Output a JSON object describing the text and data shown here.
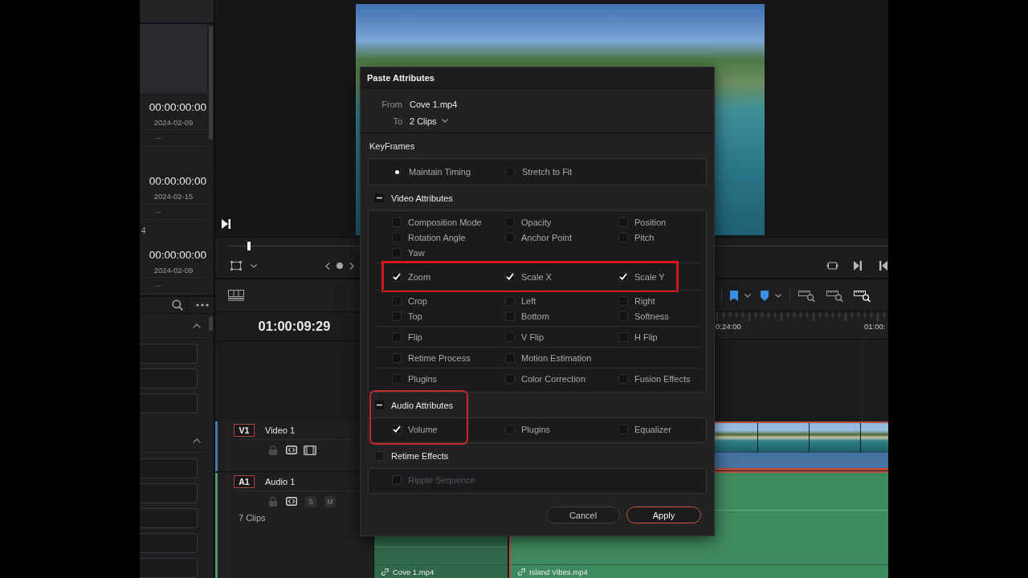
{
  "media_pool": {
    "clips": [
      {
        "timecode": "00:00:00:00",
        "date": "2024-02-09",
        "note": "---"
      },
      {
        "timecode": "00:00:00:00",
        "date": "2024-02-15",
        "note": "---",
        "partial_label": "4"
      },
      {
        "timecode": "00:00:00:00",
        "date": "2024-02-09",
        "note": "---"
      }
    ]
  },
  "inspector_panel": {
    "sections": [
      {
        "expanded": true
      },
      {
        "expanded": true
      }
    ]
  },
  "viewer": {
    "scrubber": {
      "level": 0.03
    }
  },
  "timeline": {
    "timecode": "01:00:09:29",
    "ruler": [
      "0:24:00",
      "01:00:"
    ],
    "tracks": [
      {
        "kind": "video",
        "badge": "V1",
        "name": "Video 1",
        "color": "#4a78b0"
      },
      {
        "kind": "audio",
        "badge": "A1",
        "name": "Audio 1",
        "color": "#4f9a6a",
        "buttons": [
          "S",
          "M"
        ],
        "clip_count": "7 Clips"
      }
    ],
    "video_clips": [
      {
        "selected": true
      }
    ],
    "audio_clips": [
      {
        "name": "Cove 1.mp4",
        "selected": false
      },
      {
        "name": "Island Vibes.mp4",
        "selected": true
      }
    ]
  },
  "dialog": {
    "title": "Paste Attributes",
    "from": {
      "label": "From",
      "value": "Cove 1.mp4"
    },
    "to": {
      "label": "To",
      "value": "2 Clips"
    },
    "keyframes": {
      "label": "KeyFrames",
      "options": [
        {
          "label": "Maintain Timing",
          "selected": true
        },
        {
          "label": "Stretch to Fit",
          "selected": false
        }
      ]
    },
    "sections": [
      {
        "kind": "toggle",
        "label": "Video Attributes",
        "expanded": true,
        "groups": [
          {
            "disabled": false,
            "items": [
              {
                "label": "Composition Mode",
                "checked": false
              },
              {
                "label": "Opacity",
                "checked": false
              },
              {
                "label": "Position",
                "checked": false
              },
              {
                "label": "Rotation Angle",
                "checked": false
              },
              {
                "label": "Anchor Point",
                "checked": false
              },
              {
                "label": "Pitch",
                "checked": false
              },
              {
                "label": "Yaw",
                "checked": false
              }
            ]
          },
          {
            "highlighted": true,
            "disabled": false,
            "items": [
              {
                "label": "Zoom",
                "checked": true
              },
              {
                "label": "Scale X",
                "checked": true
              },
              {
                "label": "Scale Y",
                "checked": true
              }
            ]
          },
          {
            "disabled": false,
            "items": [
              {
                "label": "Crop",
                "checked": false
              },
              {
                "label": "Left",
                "checked": false
              },
              {
                "label": "Right",
                "checked": false
              },
              {
                "label": "Top",
                "checked": false
              },
              {
                "label": "Bottom",
                "checked": false
              },
              {
                "label": "Softness",
                "checked": false
              }
            ]
          },
          {
            "disabled": false,
            "items": [
              {
                "label": "Flip",
                "checked": false
              },
              {
                "label": "V Flip",
                "checked": false
              },
              {
                "label": "H Flip",
                "checked": false
              }
            ]
          },
          {
            "disabled": false,
            "items": [
              {
                "label": "Retime Process",
                "checked": false
              },
              {
                "label": "Motion Estimation",
                "checked": false
              }
            ]
          },
          {
            "disabled": false,
            "items": [
              {
                "label": "Plugins",
                "checked": false
              },
              {
                "label": "Color Correction",
                "checked": false
              },
              {
                "label": "Fusion Effects",
                "checked": false
              }
            ]
          }
        ]
      },
      {
        "kind": "toggle",
        "label": "Audio Attributes",
        "expanded": true,
        "highlighted": true,
        "groups": [
          {
            "disabled": false,
            "items": [
              {
                "label": "Volume",
                "checked": true
              },
              {
                "label": "Plugins",
                "checked": false
              },
              {
                "label": "Equalizer",
                "checked": false
              }
            ]
          }
        ]
      },
      {
        "kind": "checkbox",
        "label": "Retime Effects",
        "checked": false,
        "groups": [
          {
            "disabled": true,
            "items": [
              {
                "label": "Ripple Sequence",
                "checked": false
              }
            ]
          }
        ]
      }
    ],
    "buttons": [
      {
        "label": "Cancel",
        "kind": "secondary"
      },
      {
        "label": "Apply",
        "kind": "primary"
      }
    ]
  }
}
